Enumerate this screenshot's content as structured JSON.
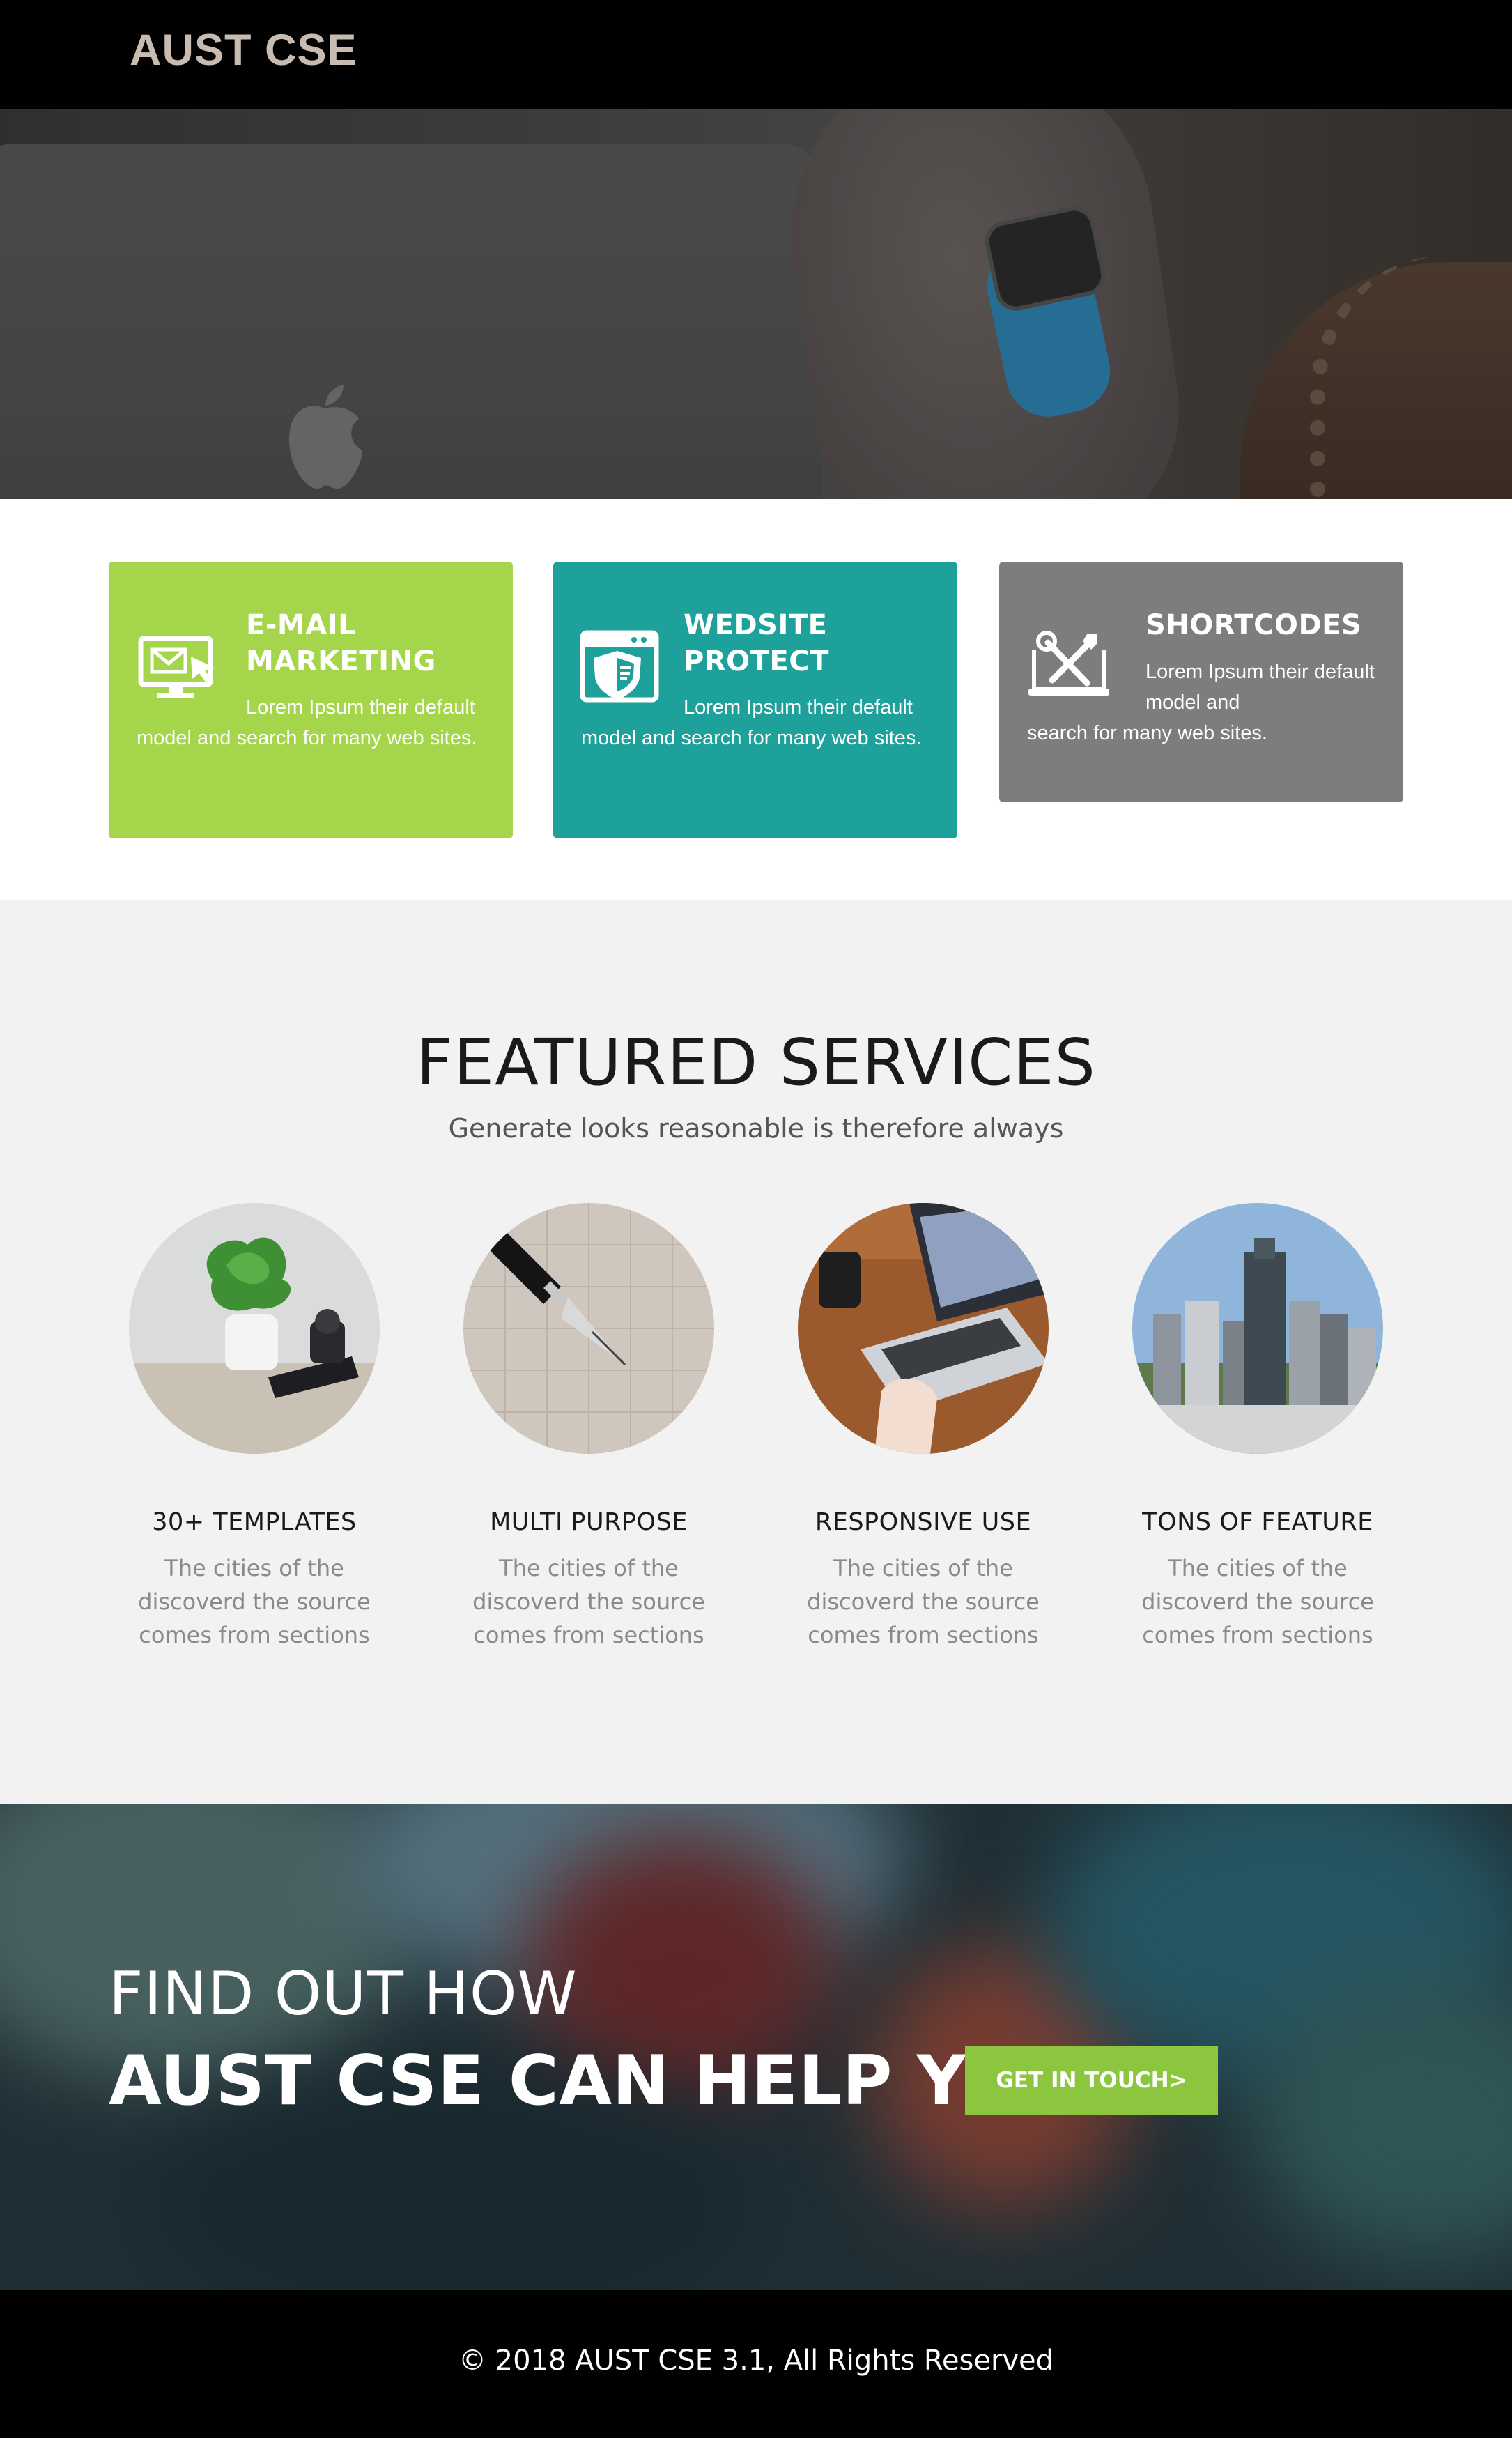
{
  "header": {
    "brand": "AUST CSE"
  },
  "features": [
    {
      "title": "E-MAIL MARKETING",
      "text": "Lorem Ipsum their default model and search for many web sites.",
      "color": "#a4d54a",
      "icon": "email-marketing-icon"
    },
    {
      "title": "WEDSITE PROTECT",
      "text": "Lorem Ipsum their default model and search for many web sites.",
      "color": "#1ea19b",
      "icon": "shield-icon"
    },
    {
      "title": "SHORTCODES",
      "text_head": "Lorem Ipsum their default model and",
      "text_tail": "search for many web sites.",
      "color": "#7d7d7d",
      "icon": "tools-icon"
    }
  ],
  "services": {
    "title": "FEATURED SERVICES",
    "subtitle": "Generate looks reasonable is therefore always",
    "items": [
      {
        "name": "30+ TEMPLATES",
        "desc": "The cities of the discoverd the source comes from sections",
        "image": "plant-photo"
      },
      {
        "name": "MULTI PURPOSE",
        "desc": "The cities of the discoverd the source comes from sections",
        "image": "fountain-pen-photo"
      },
      {
        "name": "RESPONSIVE USE",
        "desc": "The cities of the discoverd the source comes from sections",
        "image": "laptop-photo"
      },
      {
        "name": "TONS OF FEATURE",
        "desc": "The cities of the discoverd the source comes from sections",
        "image": "city-skyline-photo"
      }
    ]
  },
  "cta": {
    "line1": "FIND OUT HOW",
    "line2": "AUST CSE CAN HELP YOU",
    "button_label": "GET IN TOUCH>",
    "button_color": "#8cc63e"
  },
  "footer": {
    "text": "© 2018 AUST CSE 3.1, All Rights Reserved"
  }
}
